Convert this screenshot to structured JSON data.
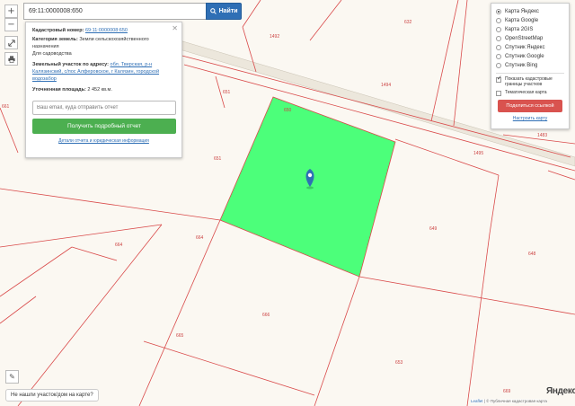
{
  "search": {
    "value": "69:11:0000008:650",
    "button_label": "Найти",
    "button_icon": "search-icon"
  },
  "tools": {
    "zoom_in": "+",
    "zoom_out": "−"
  },
  "info_panel": {
    "cadastral_number_key": "Кадастровый номер:",
    "cadastral_number_value": "69:11:0000008:650",
    "land_category_key": "Категория земель:",
    "land_category_value": "Земли сельскохозяйственного назначения",
    "land_use": "Для садоводства",
    "address_key": "Земельный участок по адресу:",
    "address_value": "обл. Тверская, р-н Калязинский, с/пос Алферовское, г Калязин, городской водозабор",
    "area_key": "Уточненная площадь:",
    "area_value": "2 452 кв.м.",
    "email_placeholder": "Ваш email, куда отправить отчет",
    "report_button": "Получить подробный отчет",
    "details_link": "Детали отчета и юридическая информация"
  },
  "layers": {
    "items": [
      {
        "label": "Карта Яндекс",
        "selected": true
      },
      {
        "label": "Карта Google",
        "selected": false
      },
      {
        "label": "Карта 2GIS",
        "selected": false
      },
      {
        "label": "OpenStreetMap",
        "selected": false
      },
      {
        "label": "Спутник Яндекс",
        "selected": false
      },
      {
        "label": "Спутник Google",
        "selected": false
      },
      {
        "label": "Спутник Bing",
        "selected": false
      }
    ],
    "show_boundaries": "Показать кадастровые границы участков",
    "show_boundaries_checked": true,
    "thematic_map": "Тематическая карта",
    "thematic_map_checked": false,
    "share_button": "Поделиться ссылкой",
    "setup_link": "Настроить карту"
  },
  "map": {
    "parcel_color": "#4cff7a",
    "boundary_color": "#d94a4a",
    "parcel_labels": [
      "632",
      "1492",
      "1494",
      "651",
      "650",
      "1495",
      "1483",
      "651",
      "661",
      "664",
      "664",
      "649",
      "648",
      "666",
      "665",
      "653",
      "669"
    ]
  },
  "bottom": {
    "not_found": "Не нашли участок/дом на карте?",
    "yandex_logo": "Яндекс",
    "attribution_leaflet": "Leaflet",
    "attribution_text": " | © Публичная кадастровая карта"
  }
}
